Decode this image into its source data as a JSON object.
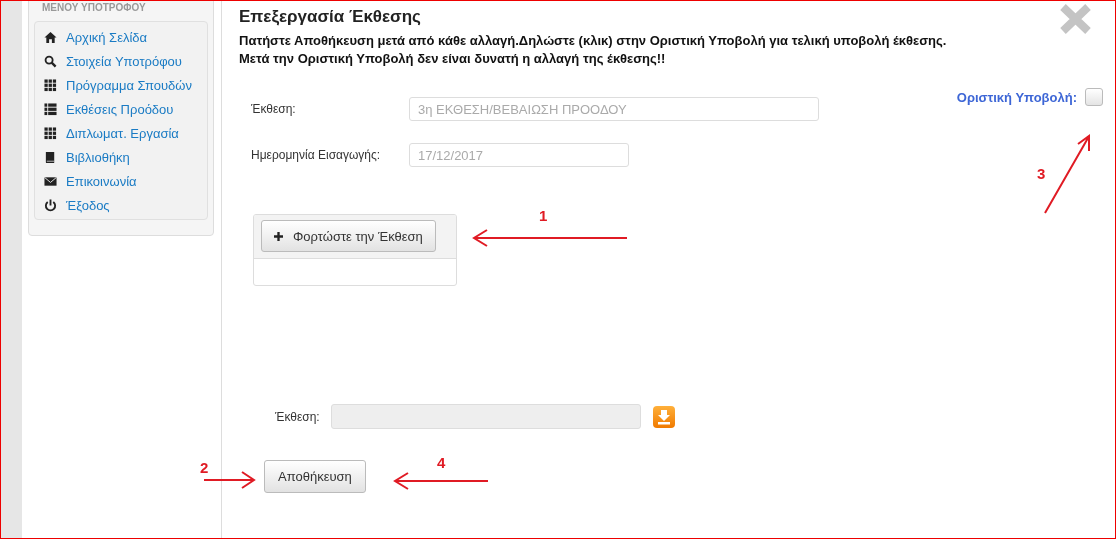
{
  "sidebar": {
    "heading": "ΜΕΝΟΥ ΥΠΟΤΡΟΦΟΥ",
    "items": [
      {
        "label": "Αρχική Σελίδα"
      },
      {
        "label": "Στοιχεία Υποτρόφου"
      },
      {
        "label": "Πρόγραμμα Σπουδών"
      },
      {
        "label": "Εκθέσεις Προόδου"
      },
      {
        "label": "Διπλωματ. Εργασία"
      },
      {
        "label": "Βιβλιοθήκη"
      },
      {
        "label": "Επικοινωνία"
      },
      {
        "label": "Έξοδος"
      }
    ]
  },
  "dialog": {
    "title": "Επεξεργασία Έκθεσης",
    "instructions": [
      "Πατήστε Αποθήκευση μετά από κάθε αλλαγή.Δηλώστε (κλικ) στην Οριστική Υποβολή για τελική υποβολή έκθεσης.",
      "Μετά την Οριστική Υποβολή δεν είναι δυνατή η αλλαγή της έκθεσης!!"
    ],
    "fields": [
      {
        "label": "Έκθεση:",
        "value": "3η ΕΚΘΕΣΗ/ΒΕΒΑΙΩΣΗ ΠΡΟΟΔΟΥ",
        "disabled": true
      },
      {
        "label": "Ημερομηνία Εισαγωγής:",
        "value": "17/12/2017",
        "disabled": true
      }
    ],
    "final_submission": {
      "label": "Οριστική Υποβολή:",
      "checked": false
    },
    "upload_button": "Φορτώστε την Έκθεση",
    "file_field": {
      "label": "Έκθεση:",
      "disabled": true
    },
    "save_button": "Αποθήκευση"
  },
  "annotations": [
    {
      "number": "1"
    },
    {
      "number": "2"
    },
    {
      "number": "3"
    },
    {
      "number": "4"
    }
  ]
}
